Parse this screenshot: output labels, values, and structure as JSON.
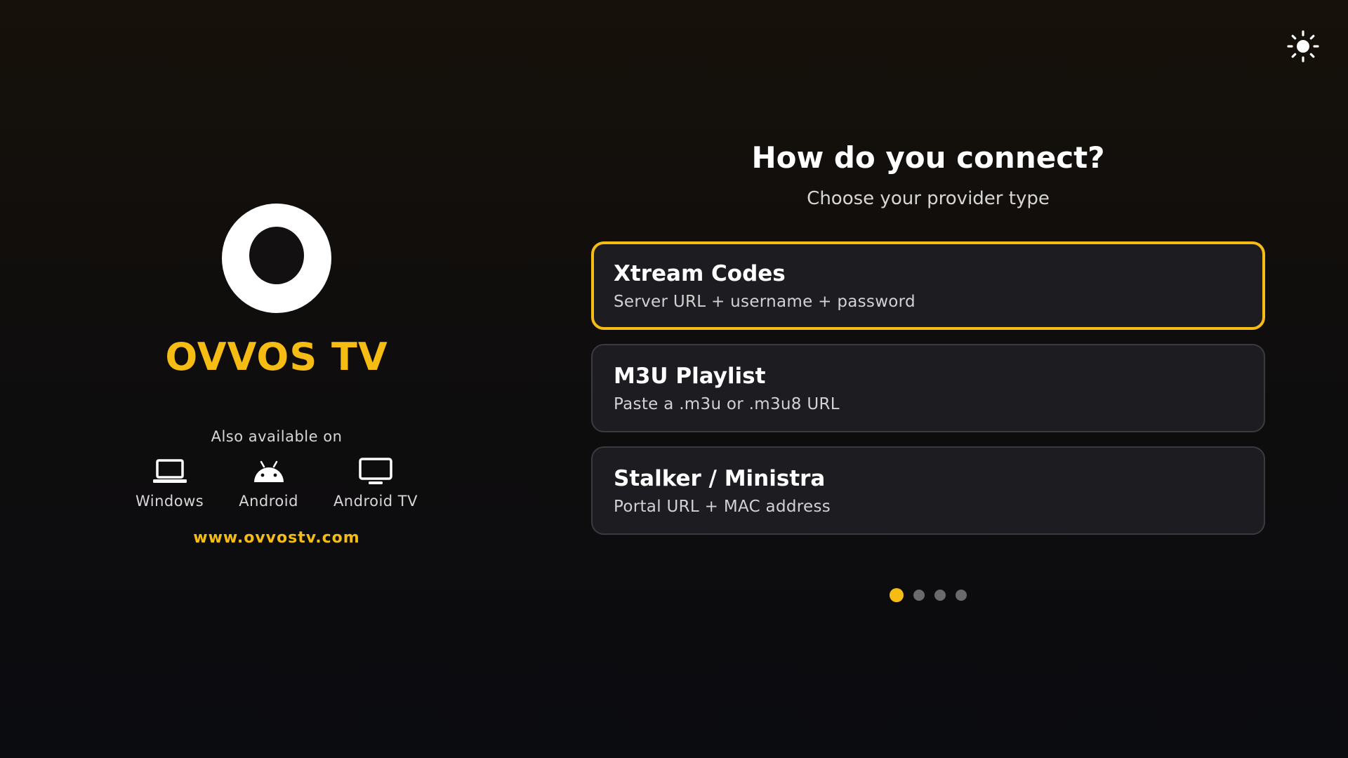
{
  "app": {
    "name": "OVVOS TV",
    "also_available_label": "Also available on",
    "platforms": [
      {
        "label": "Windows",
        "icon": "laptop-icon"
      },
      {
        "label": "Android",
        "icon": "android-icon"
      },
      {
        "label": "Android TV",
        "icon": "tv-icon"
      }
    ],
    "website": "www.ovvostv.com"
  },
  "header": {
    "theme_toggle_icon": "sun-icon"
  },
  "setup": {
    "title": "How do you connect?",
    "subtitle": "Choose your provider type",
    "options": [
      {
        "title": "Xtream Codes",
        "description": "Server URL + username + password",
        "selected": true
      },
      {
        "title": "M3U Playlist",
        "description": "Paste a .m3u or .m3u8 URL",
        "selected": false
      },
      {
        "title": "Stalker / Ministra",
        "description": "Portal URL + MAC address",
        "selected": false
      }
    ],
    "steps": {
      "total": 4,
      "current": 1
    }
  },
  "colors": {
    "accent": "#f5bd14",
    "card_bg": "#1c1c21",
    "card_border": "#3a3a40",
    "dot_inactive": "#6a6a6e"
  }
}
